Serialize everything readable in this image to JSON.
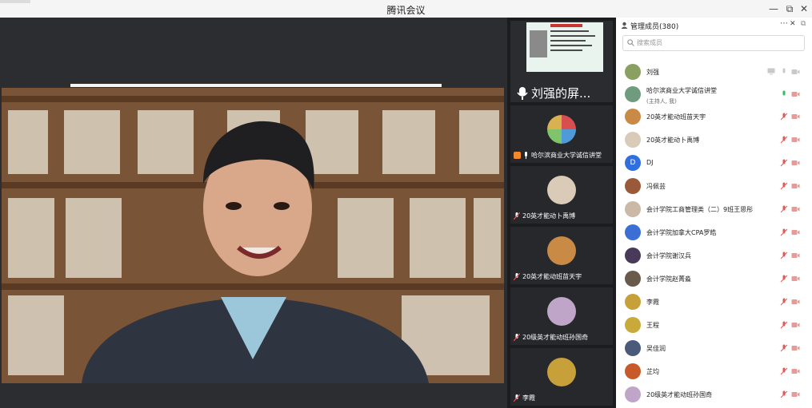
{
  "window": {
    "title": "腾讯会议",
    "controls": {
      "minimize": "—",
      "restore": "⧉",
      "close": "✕"
    }
  },
  "share": {
    "caption": "刘强的屏..."
  },
  "participants_tiles": [
    {
      "name": "哈尔滨商业大学诚信讲堂",
      "avatar_color": "#7aa37a"
    },
    {
      "name": "20英才能动卜禹博",
      "avatar_color": "#d9cbb8"
    },
    {
      "name": "20英才能动班苗天宇",
      "avatar_color": "#c88a44"
    },
    {
      "name": "20级英才能动班孙国奇",
      "avatar_color": "#bfa6c8"
    },
    {
      "name": "李霞",
      "avatar_color": "#c8a03a"
    }
  ],
  "members_panel": {
    "title": "管理成员(380)",
    "search_placeholder": "搜索成员",
    "members": [
      {
        "name": "刘强",
        "sub": "",
        "avatar_color": "#8aa060",
        "avatar_letter": ""
      },
      {
        "name": "哈尔滨商业大学诚信讲堂",
        "sub": "(主持人, 我)",
        "avatar_color": "#6f9c7f",
        "avatar_letter": ""
      },
      {
        "name": "20英才能动班苗天宇",
        "sub": "",
        "avatar_color": "#c88a44",
        "avatar_letter": ""
      },
      {
        "name": "20英才能动卜禹博",
        "sub": "",
        "avatar_color": "#d9cbb8",
        "avatar_letter": ""
      },
      {
        "name": "DJ",
        "sub": "",
        "avatar_color": "#2f6fe0",
        "avatar_letter": "D"
      },
      {
        "name": "冯佩芸",
        "sub": "",
        "avatar_color": "#9a5a3a",
        "avatar_letter": ""
      },
      {
        "name": "会计学院工商管理类（二）9班王思彤",
        "sub": "",
        "avatar_color": "#c9b9a6",
        "avatar_letter": ""
      },
      {
        "name": "会计学院加拿大CPA罗皓",
        "sub": "",
        "avatar_color": "#3b6fd6",
        "avatar_letter": ""
      },
      {
        "name": "会计学院谢汉兵",
        "sub": "",
        "avatar_color": "#4a3a5a",
        "avatar_letter": ""
      },
      {
        "name": "会计学院赵菁淼",
        "sub": "",
        "avatar_color": "#6a5a4a",
        "avatar_letter": ""
      },
      {
        "name": "李霞",
        "sub": "",
        "avatar_color": "#c8a03a",
        "avatar_letter": ""
      },
      {
        "name": "王程",
        "sub": "",
        "avatar_color": "#c9a93a",
        "avatar_letter": ""
      },
      {
        "name": "吴佳润",
        "sub": "",
        "avatar_color": "#4a5a7a",
        "avatar_letter": ""
      },
      {
        "name": "芷均",
        "sub": "",
        "avatar_color": "#c85a2a",
        "avatar_letter": ""
      },
      {
        "name": "20级英才能动班孙国奇",
        "sub": "",
        "avatar_color": "#bfa6c8",
        "avatar_letter": ""
      }
    ]
  },
  "colors": {
    "mic_muted": "#e05a5a",
    "mic_active": "#2fbf5f",
    "icon_gray": "#c9c9c9",
    "stage_bg": "#2b2d30",
    "thumbs_bg": "#1b1c1e"
  }
}
